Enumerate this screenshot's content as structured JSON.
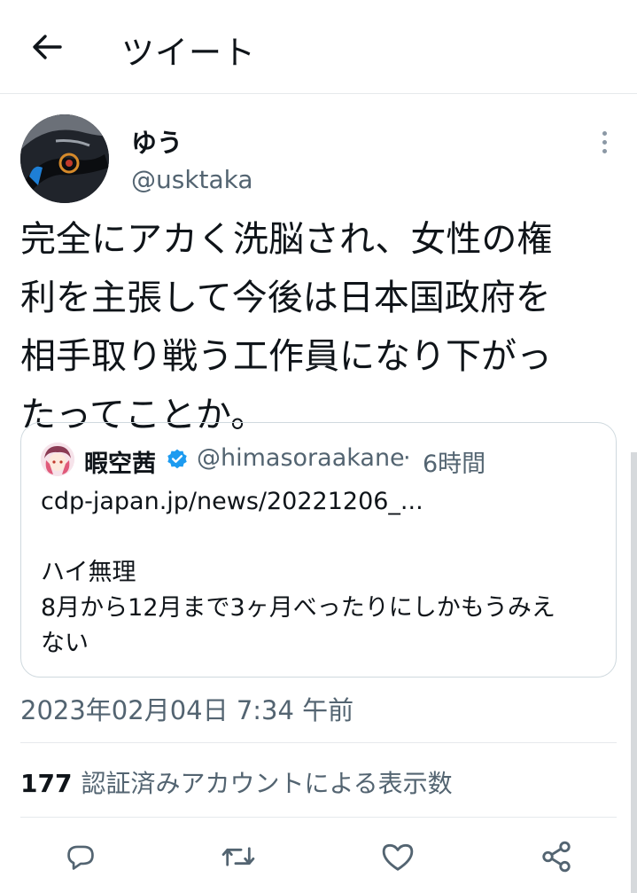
{
  "header": {
    "title": "ツイート",
    "back_icon": "arrow-left-icon"
  },
  "tweet": {
    "display_name": "ゆう",
    "handle": "@usktaka",
    "text": "完全にアカく洗脳され、女性の権\n利を主張して今後は日本国政府を\n相手取り戦う工作員になり下がっ\nたってことか。",
    "timestamp": "2023年02月04日 7:34 午前"
  },
  "quote": {
    "display_name": "暇空茜",
    "verified": true,
    "handle": "@himasoraakane",
    "separator": "·",
    "time": "6時間",
    "text": "cdp-japan.jp/news/20221206_...\n\nハイ無理\n8月から12月まで3ヶ月べったりにしかもうみえ\nない"
  },
  "stats": {
    "count": "177",
    "label": "認証済みアカウントによる表示数"
  },
  "actions": [
    "reply-icon",
    "retweet-icon",
    "like-icon",
    "share-icon"
  ],
  "colors": {
    "text": "#0f1419",
    "secondary": "#536471",
    "verified": "#1d9bf0",
    "border": "#cfd9de"
  }
}
